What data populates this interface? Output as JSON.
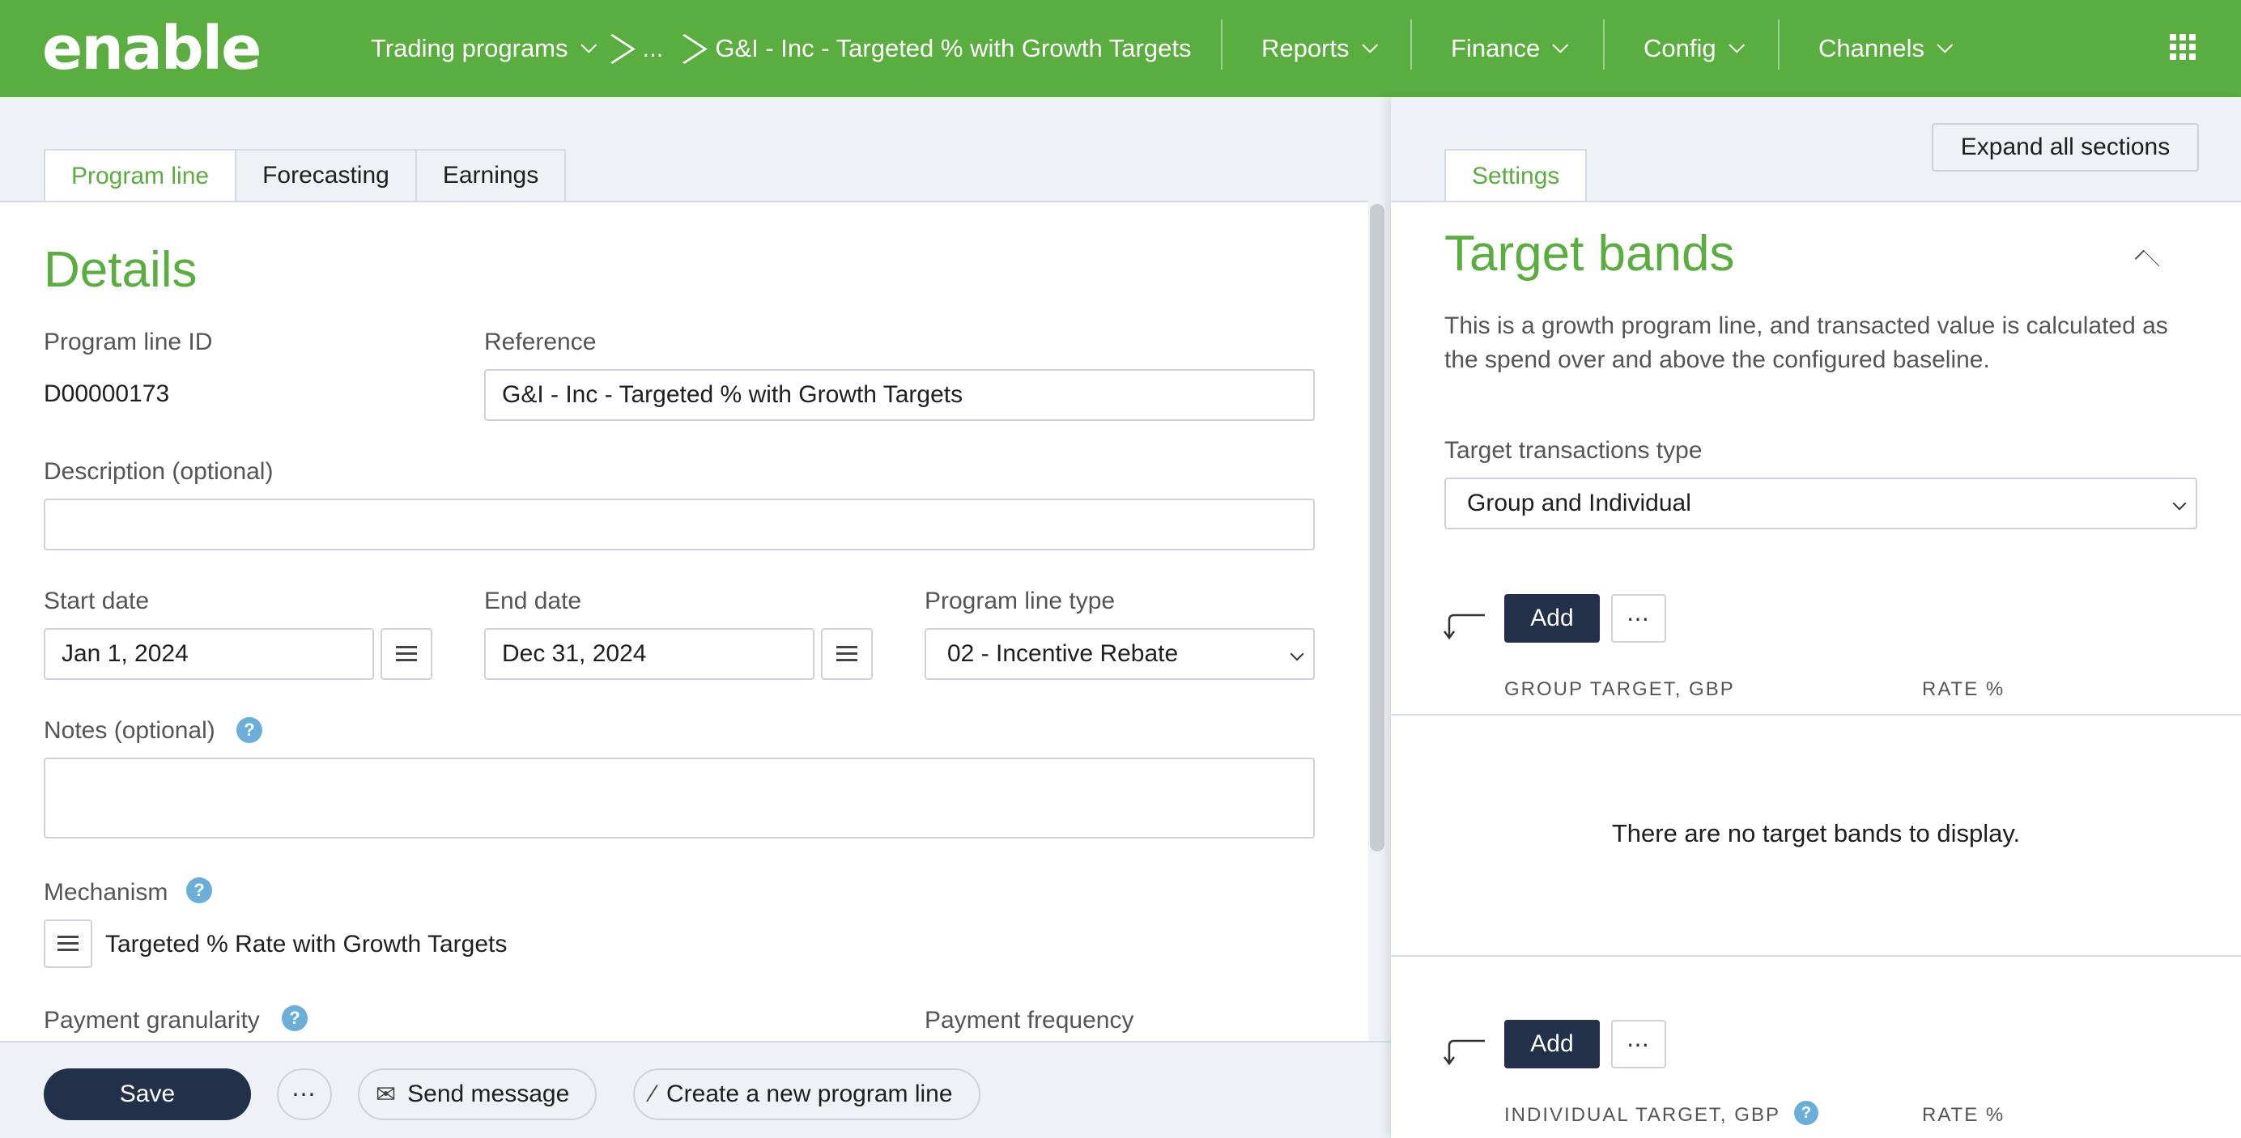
{
  "header": {
    "logo": "enable",
    "breadcrumb": {
      "root": "Trading programs",
      "ellipsis": "...",
      "current": "G&I - Inc - Targeted % with Growth Targets"
    },
    "nav": [
      "Reports",
      "Finance",
      "Config",
      "Channels"
    ]
  },
  "tabs": [
    "Program line",
    "Forecasting",
    "Earnings"
  ],
  "details": {
    "title": "Details",
    "program_line_id_label": "Program line ID",
    "program_line_id": "D00000173",
    "reference_label": "Reference",
    "reference_value": "G&I - Inc - Targeted % with Growth Targets",
    "description_label": "Description (optional)",
    "description_value": "",
    "start_date_label": "Start date",
    "start_date": "Jan 1, 2024",
    "end_date_label": "End date",
    "end_date": "Dec 31, 2024",
    "program_line_type_label": "Program line type",
    "program_line_type": "02 - Incentive Rebate",
    "notes_label": "Notes (optional)",
    "notes_value": "",
    "mechanism_label": "Mechanism",
    "mechanism_value": "Targeted % Rate with Growth Targets",
    "payment_granularity_label": "Payment granularity",
    "payment_frequency_label": "Payment frequency"
  },
  "footer": {
    "save": "Save",
    "more": "⋯",
    "send_message": "Send message",
    "create_line": "Create a new program line"
  },
  "settings": {
    "expand_all": "Expand all sections",
    "tab": "Settings",
    "title": "Target bands",
    "description": "This is a growth program line, and transacted value is calculated as the spend over and above the configured baseline.",
    "target_type_label": "Target transactions type",
    "target_type_value": "Group and Individual",
    "add_label": "Add",
    "more": "⋯",
    "group_col": "GROUP TARGET, GBP",
    "rate_col": "RATE %",
    "empty_message": "There are no target bands to display.",
    "individual_col": "INDIVIDUAL TARGET, GBP",
    "rate_col_2": "RATE %"
  },
  "colors": {
    "brand_green": "#5aad3f",
    "dark_button": "#223049",
    "help_blue": "#6aaed9"
  }
}
